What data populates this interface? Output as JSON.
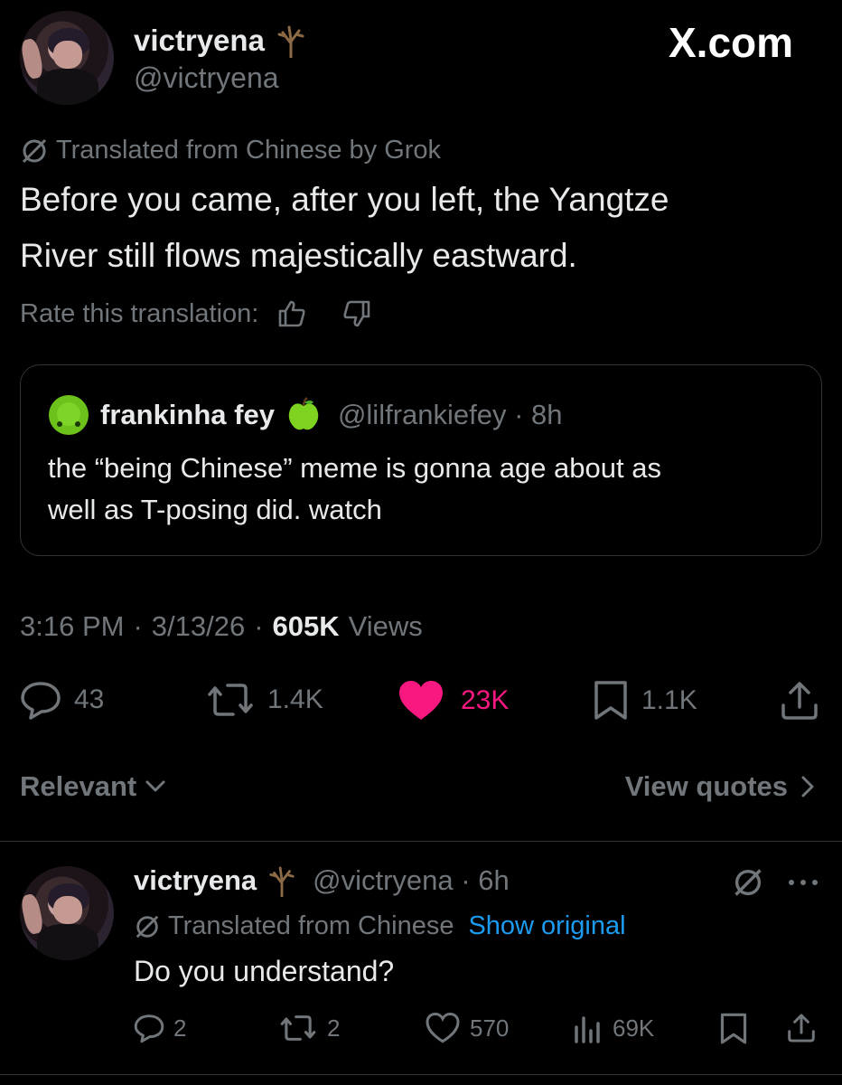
{
  "brand": {
    "text": "X.com"
  },
  "post": {
    "display_name": "victryena",
    "handle": "@victryena",
    "translated_note": "Translated from Chinese by Grok",
    "text_line1": "Before you came, after you left, the Yangtze",
    "text_line2": "River still flows majestically eastward.",
    "rate_label": "Rate this translation:",
    "quote": {
      "display_name": "frankinha fey",
      "handle_time": "@lilfrankiefey · 8h",
      "text_line1": "the “being Chinese” meme is gonna age about as",
      "text_line2": "well as T-posing did. watch"
    },
    "time": "3:16 PM",
    "date": "3/13/26",
    "views_count": "605K",
    "views_label": "Views",
    "stats": {
      "replies": "43",
      "reposts": "1.4K",
      "likes": "23K",
      "bookmarks": "1.1K"
    }
  },
  "filters": {
    "sort": "Relevant",
    "view_quotes": "View quotes"
  },
  "reply": {
    "display_name": "victryena",
    "handle_time": "@victryena · 6h",
    "translated_note": "Translated from Chinese",
    "show_original": "Show original",
    "text": "Do you understand?",
    "stats": {
      "replies": "2",
      "reposts": "2",
      "likes": "570",
      "views": "69K"
    }
  },
  "colors": {
    "like_active": "#f91880",
    "link": "#1d9bf0",
    "muted": "#71767b",
    "apple": "#7ed321",
    "blob": "#6cc11a"
  },
  "icons": [
    "tree-emoji-icon",
    "grok-slash-icon",
    "thumbs-up-icon",
    "thumbs-down-icon",
    "green-blob-icon",
    "green-apple-icon",
    "reply-icon",
    "repost-icon",
    "heart-icon",
    "bookmark-icon",
    "share-icon",
    "chevron-down-icon",
    "chevron-right-icon",
    "more-icon",
    "views-icon"
  ]
}
